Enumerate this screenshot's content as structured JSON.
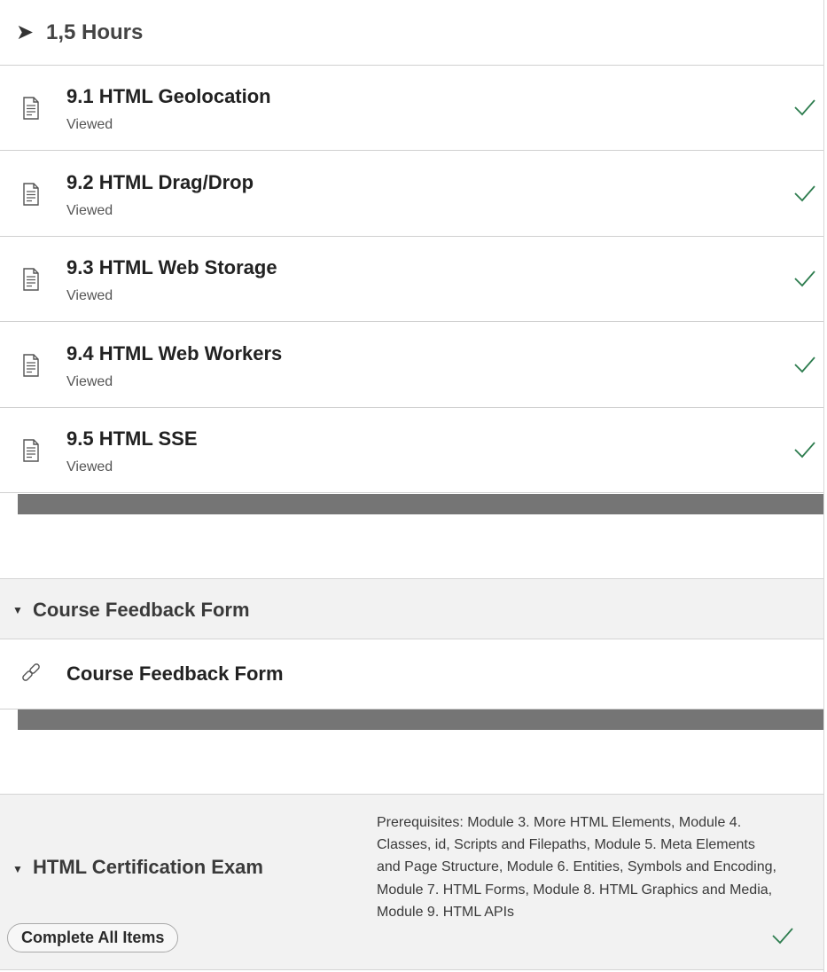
{
  "duration": {
    "arrow": "➤",
    "label": "1,5 Hours"
  },
  "items": [
    {
      "title": "9.1 HTML Geolocation",
      "status": "Viewed"
    },
    {
      "title": "9.2 HTML Drag/Drop",
      "status": "Viewed"
    },
    {
      "title": "9.3 HTML Web Storage",
      "status": "Viewed"
    },
    {
      "title": "9.4 HTML Web Workers",
      "status": "Viewed"
    },
    {
      "title": "9.5 HTML SSE",
      "status": "Viewed"
    }
  ],
  "feedback": {
    "section_title": "Course Feedback Form",
    "link_title": "Course Feedback Form"
  },
  "exam": {
    "section_title": "HTML Certification Exam",
    "prerequisites_lines": [
      "Prerequisites: Module 3. More HTML Elements, Module 4.",
      "Classes, id, Scripts and Filepaths, Module 5. Meta Elements",
      "and Page Structure, Module 6. Entities, Symbols and Encoding,",
      "Module 7. HTML Forms, Module 8. HTML Graphics and Media,",
      "Module 9. HTML APIs"
    ],
    "complete_button": "Complete All Items"
  },
  "icons": {
    "caret": "▼"
  },
  "colors": {
    "check_green": "#2e7d4f",
    "divider_bar": "#757575",
    "section_bg": "#f2f2f2"
  }
}
